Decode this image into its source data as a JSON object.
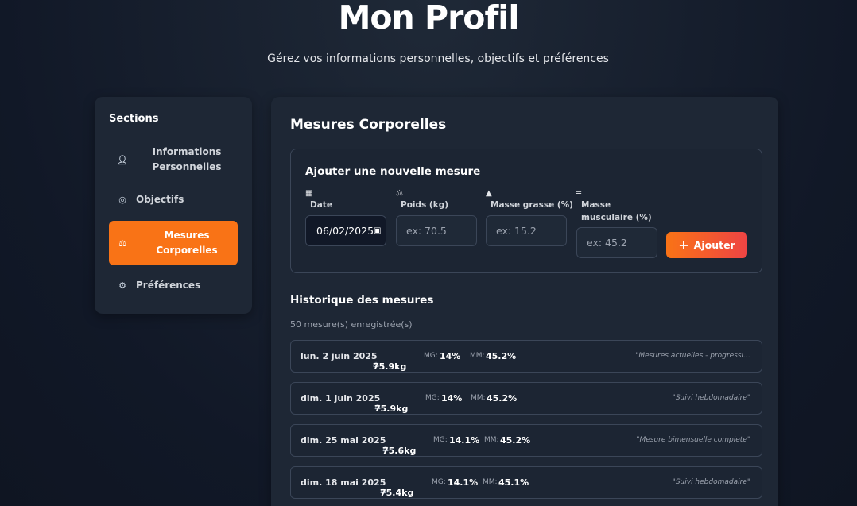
{
  "header": {
    "title": "Mon Profil",
    "subtitle": "Gérez vos informations personnelles, objectifs et préférences"
  },
  "sidebar": {
    "title": "Sections",
    "items": [
      {
        "label": "Informations Personnelles",
        "icon": "user-icon"
      },
      {
        "label": "Objectifs",
        "icon": "target-icon"
      },
      {
        "label": "Mesures Corporelles",
        "icon": "scale-icon",
        "active": true
      },
      {
        "label": "Préférences",
        "icon": "gear-icon"
      }
    ]
  },
  "main": {
    "title": "Mesures Corporelles",
    "form": {
      "title": "Ajouter une nouvelle mesure",
      "date_label": "Date",
      "date_value": "06/02/2025",
      "weight_label": "Poids (kg)",
      "weight_placeholder": "ex: 70.5",
      "fat_label": "Masse grasse (%)",
      "fat_placeholder": "ex: 15.2",
      "muscle_label": "Masse musculaire (%)",
      "muscle_placeholder": "ex: 45.2",
      "add_label": "Ajouter"
    },
    "history": {
      "title": "Historique des mesures",
      "count": "50 mesure(s) enregistrée(s)",
      "mg_label": "MG:",
      "mm_label": "MM:",
      "rows": [
        {
          "date": "lun. 2 juin 2025",
          "weight": "75.9kg",
          "mg": "14%",
          "mm": "45.2%",
          "note": "\"Mesures actuelles - progressi…"
        },
        {
          "date": "dim. 1 juin 2025",
          "weight": "75.9kg",
          "mg": "14%",
          "mm": "45.2%",
          "note": "\"Suivi hebdomadaire\""
        },
        {
          "date": "dim. 25 mai 2025",
          "weight": "75.6kg",
          "mg": "14.1%",
          "mm": "45.2%",
          "note": "\"Mesure bimensuelle complete\""
        },
        {
          "date": "dim. 18 mai 2025",
          "weight": "75.4kg",
          "mg": "14.1%",
          "mm": "45.1%",
          "note": "\"Suivi hebdomadaire\""
        }
      ]
    }
  },
  "colors": {
    "accent": "#f97316",
    "accent_end": "#ef4444",
    "card": "#1e2735",
    "background": "#111827"
  }
}
